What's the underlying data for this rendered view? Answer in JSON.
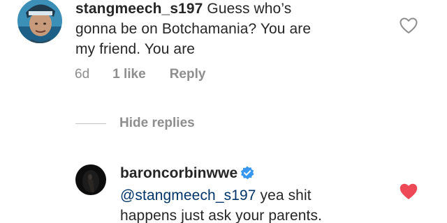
{
  "comment": {
    "username": "stangmeech_s197",
    "text_line1": " Guess who’s",
    "text_line2": "gonna be on Botchamania?  You are",
    "text_line3": "my friend. You are",
    "time": "6d",
    "likes": "1 like",
    "reply": "Reply",
    "liked": false
  },
  "hide_replies": "Hide replies",
  "reply": {
    "username": "baroncorbinwwe",
    "verified": true,
    "mention": "@stangmeech_s197",
    "text_line1": " yea shit",
    "text_line2": "happens just ask your parents.",
    "liked": true
  },
  "colors": {
    "text": "#262626",
    "secondary": "#8e8e8e",
    "mention": "#003569",
    "heart_liked": "#ed4956",
    "verified": "#3897f0"
  },
  "icons": {
    "comment_like": "heart-outline-icon",
    "reply_like": "heart-filled-icon",
    "verified": "verified-badge-icon"
  }
}
